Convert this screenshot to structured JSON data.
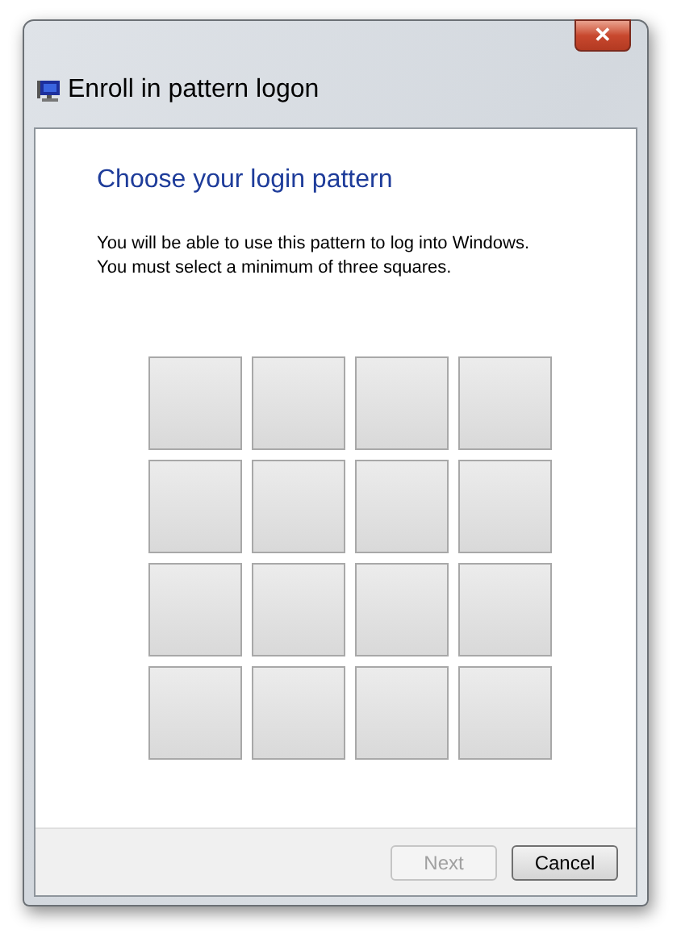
{
  "window": {
    "title": "Enroll in pattern logon",
    "close": "✕"
  },
  "heading": "Choose your login pattern",
  "description": [
    "You will be able to use this pattern to log into Windows.",
    "You must select a minimum of three squares."
  ],
  "squares": [
    {
      "selected": false
    },
    {
      "selected": false
    },
    {
      "selected": false
    },
    {
      "selected": false
    },
    {
      "selected": false
    },
    {
      "selected": false
    },
    {
      "selected": false
    },
    {
      "selected": false
    },
    {
      "selected": false
    },
    {
      "selected": false
    },
    {
      "selected": false
    },
    {
      "selected": false
    },
    {
      "selected": false
    },
    {
      "selected": false
    },
    {
      "selected": false
    },
    {
      "selected": false
    }
  ],
  "buttons": [
    {
      "label": "Next",
      "disabled": true
    },
    {
      "label": "Cancel",
      "disabled": false
    }
  ]
}
